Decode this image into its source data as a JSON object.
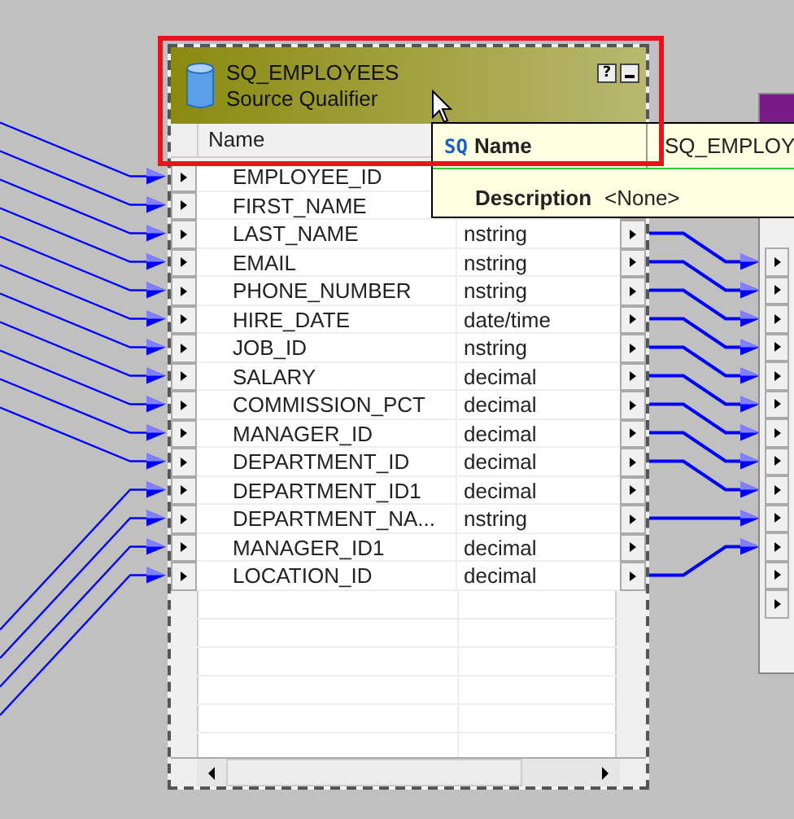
{
  "transformation": {
    "title": "SQ_EMPLOYEES",
    "subtitle": "Source Qualifier",
    "help_button": "?",
    "column_header": "Name",
    "fields": [
      {
        "name": "EMPLOYEE_ID"
      },
      {
        "name": "FIRST_NAME"
      },
      {
        "name": "LAST_NAME",
        "datatype": "nstring"
      },
      {
        "name": "EMAIL",
        "datatype": "nstring"
      },
      {
        "name": "PHONE_NUMBER",
        "datatype": "nstring"
      },
      {
        "name": "HIRE_DATE",
        "datatype": "date/time"
      },
      {
        "name": "JOB_ID",
        "datatype": "nstring"
      },
      {
        "name": "SALARY",
        "datatype": "decimal"
      },
      {
        "name": "COMMISSION_PCT",
        "datatype": "decimal"
      },
      {
        "name": "MANAGER_ID",
        "datatype": "decimal"
      },
      {
        "name": "DEPARTMENT_ID",
        "datatype": "decimal"
      },
      {
        "name": "DEPARTMENT_ID1",
        "datatype": "decimal"
      },
      {
        "name": "DEPARTMENT_NA...",
        "datatype": "nstring"
      },
      {
        "name": "MANAGER_ID1",
        "datatype": "decimal"
      },
      {
        "name": "LOCATION_ID",
        "datatype": "decimal"
      }
    ]
  },
  "tooltip": {
    "icon_text": "SQ",
    "name_label": "Name",
    "name_value": "SQ_EMPLOY",
    "description_label": "Description",
    "description_value": "<None>"
  }
}
